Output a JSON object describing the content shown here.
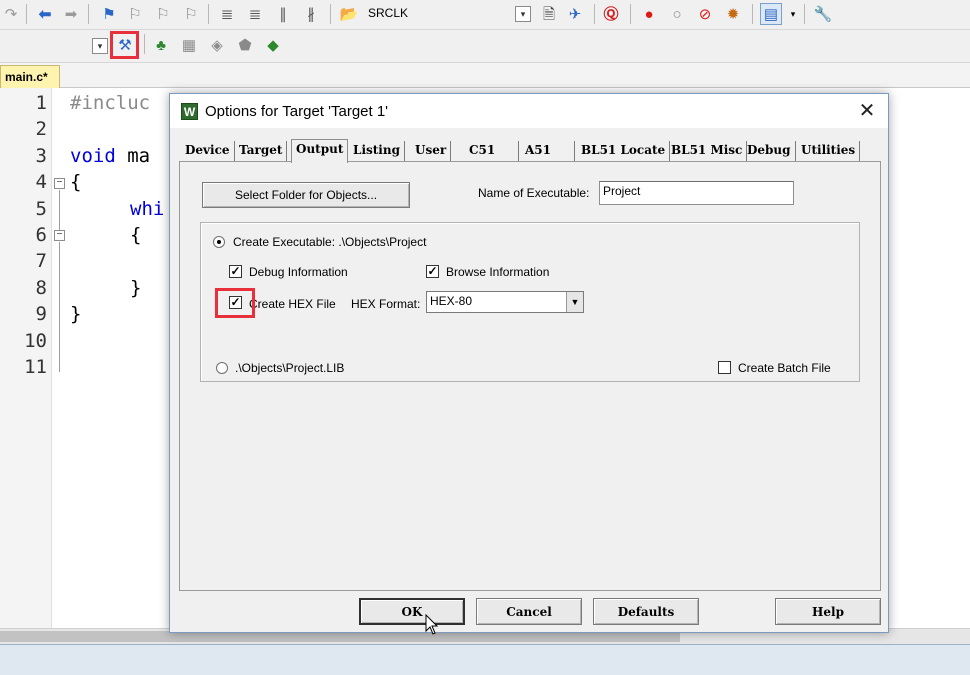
{
  "toolbar": {
    "target_name": "SRCLK",
    "colors": {
      "highlight": "#e8303a"
    }
  },
  "editor": {
    "tab_label": "main.c*",
    "line_numbers": [
      "1",
      "2",
      "3",
      "4",
      "5",
      "6",
      "7",
      "8",
      "9",
      "10",
      "11"
    ],
    "lines": {
      "l1": "#incluc",
      "l3_kw": "void",
      "l3_rest": " ma",
      "l4": "{",
      "l5": "whi",
      "l6": "{",
      "l8": "}",
      "l9": "}"
    }
  },
  "dialog": {
    "title": "Options for Target 'Target 1'",
    "title_icon": "W",
    "close_glyph": "✕",
    "tabs": [
      "Device",
      "Target",
      "Output",
      "Listing",
      "User",
      "C51",
      "A51",
      "BL51 Locate",
      "BL51 Misc",
      "Debug",
      "Utilities"
    ],
    "active_tab": "Output",
    "output": {
      "select_folder_label": "Select Folder for Objects...",
      "name_of_executable_label": "Name of Executable:",
      "name_of_executable_value": "Project",
      "create_executable_label": "Create Executable:  .\\Objects\\Project",
      "create_executable_selected": true,
      "debug_info_label": "Debug Information",
      "debug_info_checked": true,
      "browse_info_label": "Browse Information",
      "browse_info_checked": true,
      "create_hex_label": "Create HEX File",
      "create_hex_checked": true,
      "hex_format_label": "HEX Format:",
      "hex_format_value": "HEX-80",
      "library_label": ".\\Objects\\Project.LIB",
      "library_selected": false,
      "create_batch_label": "Create Batch File",
      "create_batch_checked": false
    },
    "buttons": {
      "ok": "OK",
      "cancel": "Cancel",
      "defaults": "Defaults",
      "help": "Help"
    }
  }
}
